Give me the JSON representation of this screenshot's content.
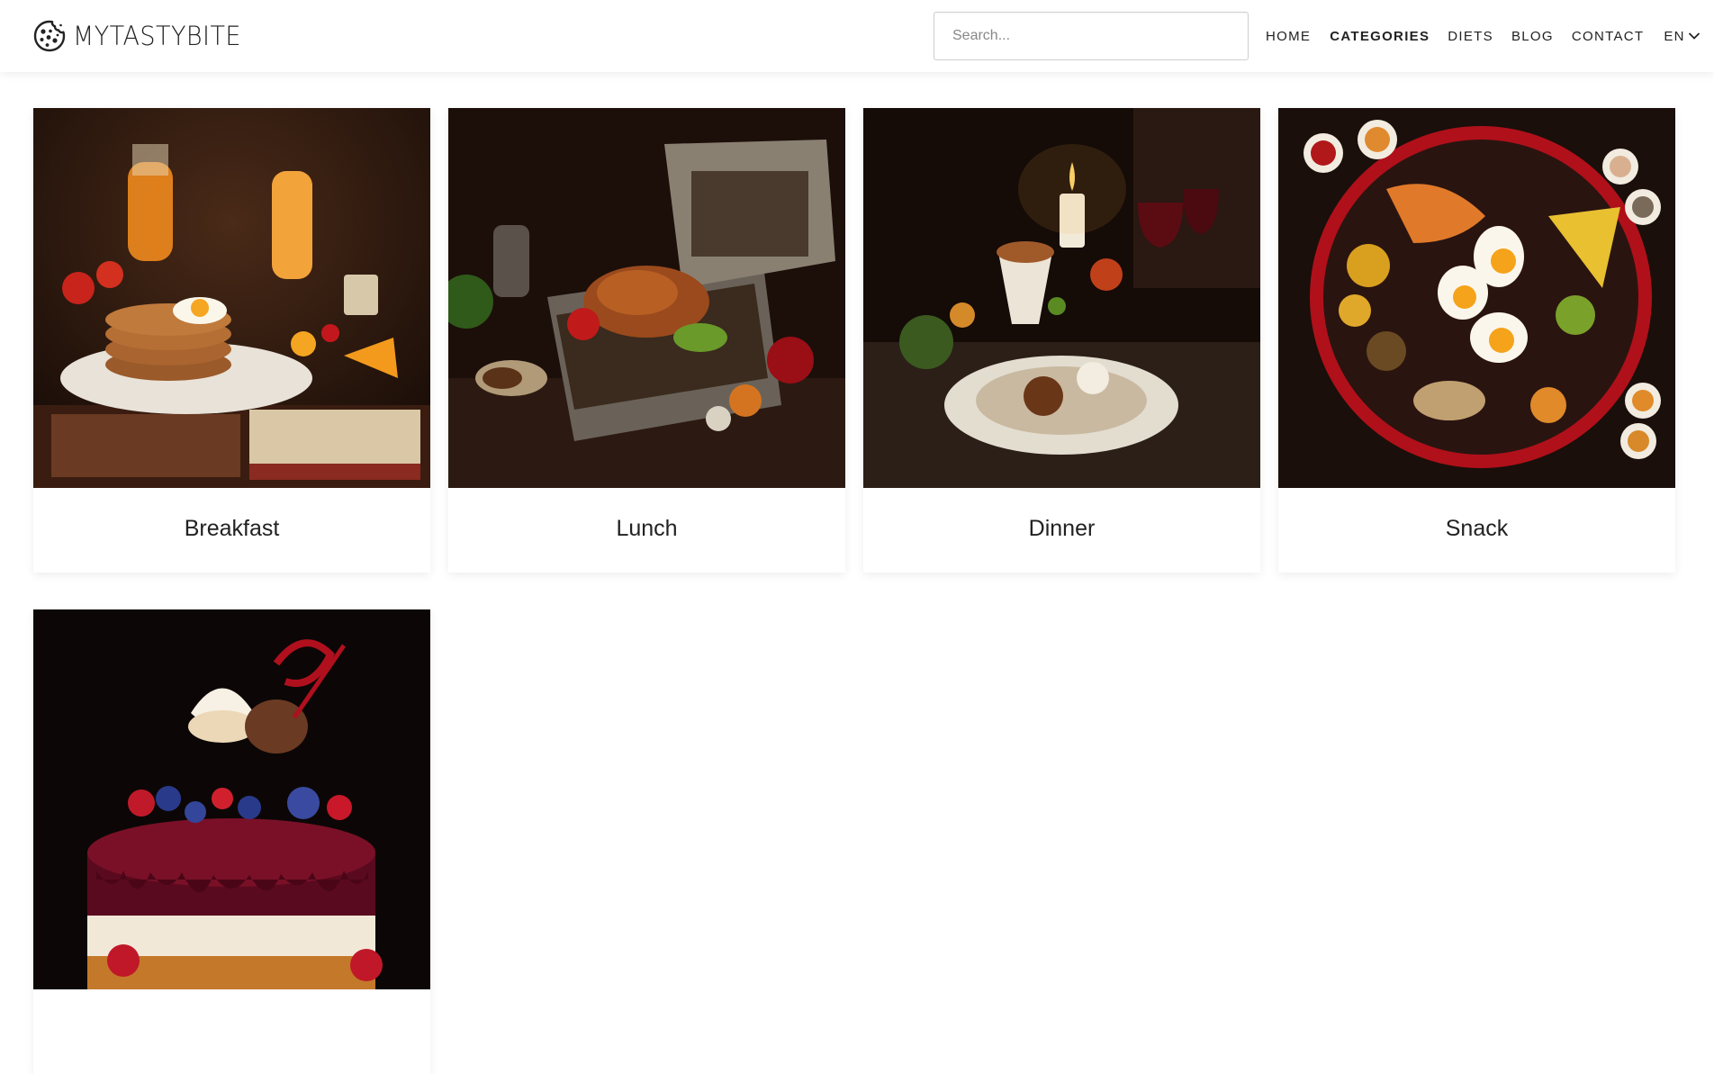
{
  "brand": {
    "name": "MYTASTYBITE",
    "logo_icon": "cookie-icon"
  },
  "search": {
    "placeholder": "Search...",
    "value": ""
  },
  "nav": {
    "items": [
      {
        "label": "HOME",
        "active": false
      },
      {
        "label": "CATEGORIES",
        "active": true
      },
      {
        "label": "DIETS",
        "active": false
      },
      {
        "label": "BLOG",
        "active": false
      },
      {
        "label": "CONTACT",
        "active": false
      }
    ],
    "language": {
      "label": "EN",
      "icon": "chevron-down-icon"
    }
  },
  "categories": [
    {
      "title": "Breakfast",
      "image": "breakfast-image"
    },
    {
      "title": "Lunch",
      "image": "lunch-image"
    },
    {
      "title": "Dinner",
      "image": "dinner-image"
    },
    {
      "title": "Snack",
      "image": "snack-image"
    },
    {
      "title": "",
      "image": "dessert-image"
    }
  ],
  "colors": {
    "header_bg": "#ffffff",
    "page_bg": "#ffffff",
    "text": "#222222",
    "search_border": "#cfcfcf"
  }
}
